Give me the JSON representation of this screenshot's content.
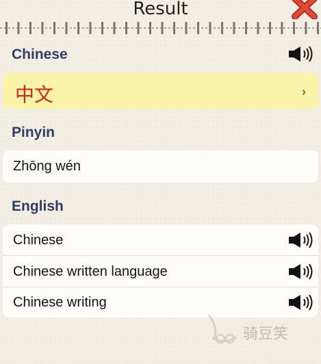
{
  "header": {
    "title": "Result",
    "close_icon": "close-x-icon",
    "accent_close": "#d93a2b"
  },
  "sections": {
    "chinese": {
      "label": "Chinese",
      "value": "中文",
      "value_color": "#d9221d",
      "highlight_bg": "#fbf3a8",
      "chevron": "›",
      "speaker_icon": "speaker-icon"
    },
    "pinyin": {
      "label": "Pinyin",
      "value": "Zhōng wén"
    },
    "english": {
      "label": "English",
      "items": [
        {
          "text": "Chinese",
          "icon": "speaker-icon"
        },
        {
          "text": "Chinese written language",
          "icon": "speaker-icon"
        },
        {
          "text": "Chinese writing",
          "icon": "speaker-icon"
        }
      ]
    }
  },
  "watermark": {
    "text": "骑豆笑"
  },
  "colors": {
    "section_label": "#2e3c66",
    "background": "#f3eee4"
  }
}
